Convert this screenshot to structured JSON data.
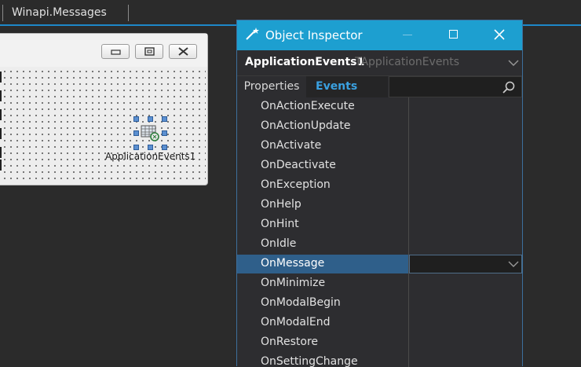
{
  "editor": {
    "tab_label": "Winapi.Messages"
  },
  "form_designer": {
    "component_label": "ApplicationEvents1"
  },
  "object_inspector": {
    "title": "Object Inspector",
    "object_name": "ApplicationEvents1",
    "object_class": "TApplicationEvents",
    "tabs": {
      "properties": "Properties",
      "events": "Events"
    },
    "search_placeholder": "",
    "selected_event": "OnMessage",
    "events": [
      "OnActionExecute",
      "OnActionUpdate",
      "OnActivate",
      "OnDeactivate",
      "OnException",
      "OnHelp",
      "OnHint",
      "OnIdle",
      "OnMessage",
      "OnMinimize",
      "OnModalBegin",
      "OnModalEnd",
      "OnRestore",
      "OnSettingChange"
    ]
  },
  "colors": {
    "title_bar": "#1d9fd0",
    "accent": "#1e88c8",
    "selected_row": "#2f5f8a",
    "events_tab_text": "#3aa0e0"
  },
  "icons": [
    "minimize-icon",
    "restore-icon",
    "close-icon",
    "maximize-icon",
    "search-icon",
    "chevron-down-icon",
    "wand-icon",
    "component-icon"
  ]
}
